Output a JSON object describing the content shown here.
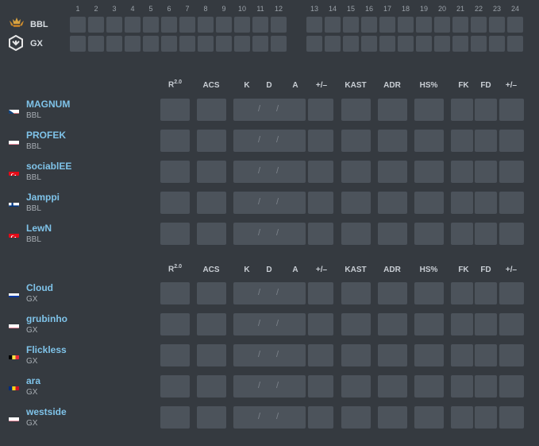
{
  "rounds": [
    "1",
    "2",
    "3",
    "4",
    "5",
    "6",
    "7",
    "8",
    "9",
    "10",
    "11",
    "12",
    "13",
    "14",
    "15",
    "16",
    "17",
    "18",
    "19",
    "20",
    "21",
    "22",
    "23",
    "24"
  ],
  "teams": [
    {
      "code": "BBL",
      "logo": "crown-wings-logo-icon",
      "color": "#d59a3a"
    },
    {
      "code": "GX",
      "logo": "gx-logo-icon",
      "color": "#e6e6e6"
    }
  ],
  "stat_headers": {
    "rating_base": "R",
    "rating_sup": "2.0",
    "acs": "ACS",
    "k": "K",
    "d": "D",
    "a": "A",
    "pm": "+/–",
    "kast": "KAST",
    "adr": "ADR",
    "hs": "HS%",
    "fk": "FK",
    "fd": "FD",
    "fkpm": "+/–"
  },
  "kda_separator": "/",
  "rosters": [
    {
      "team": "BBL",
      "players": [
        {
          "name": "MAGNUM",
          "team": "BBL",
          "flag": "czech-flag-icon"
        },
        {
          "name": "PROFEK",
          "team": "BBL",
          "flag": "poland-flag-icon"
        },
        {
          "name": "sociablEE",
          "team": "BBL",
          "flag": "turkey-flag-icon"
        },
        {
          "name": "Jamppi",
          "team": "BBL",
          "flag": "finland-flag-icon"
        },
        {
          "name": "LewN",
          "team": "BBL",
          "flag": "turkey-flag-icon"
        }
      ]
    },
    {
      "team": "GX",
      "players": [
        {
          "name": "Cloud",
          "team": "GX",
          "flag": "russia-flag-icon"
        },
        {
          "name": "grubinho",
          "team": "GX",
          "flag": "poland-flag-icon"
        },
        {
          "name": "Flickless",
          "team": "GX",
          "flag": "belgium-flag-icon"
        },
        {
          "name": "ara",
          "team": "GX",
          "flag": "romania-flag-icon"
        },
        {
          "name": "westside",
          "team": "GX",
          "flag": "poland-flag-icon"
        }
      ]
    }
  ],
  "colors": {
    "background": "#353a40",
    "cell": "#4c535b",
    "player_link": "#7fc3e9"
  }
}
